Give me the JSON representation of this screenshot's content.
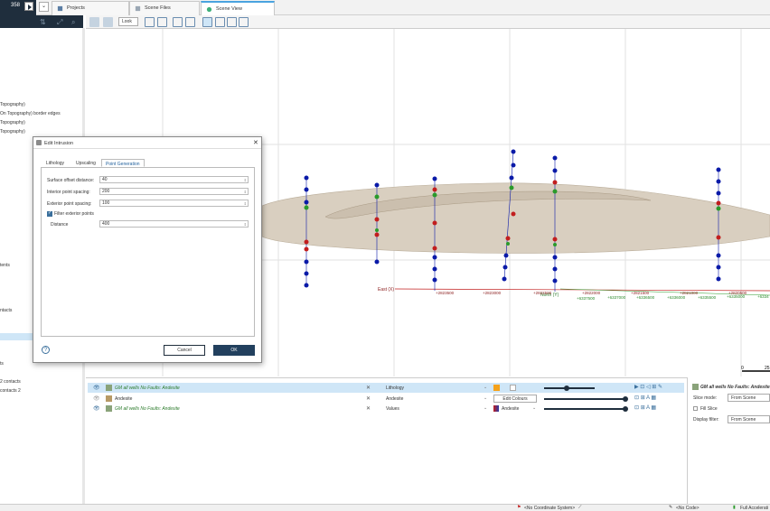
{
  "top": {
    "scene_count": "358",
    "tabs": [
      {
        "label": "Projects"
      },
      {
        "label": "Scene Files"
      },
      {
        "label": "Scene View"
      }
    ]
  },
  "toolbar": {
    "look_label": "Look"
  },
  "left_tree": {
    "items": [
      "Topography)",
      "On Topography) border edges",
      "Topography)",
      "Topography)",
      "tents",
      "ntacts",
      "ts",
      "2 contacts",
      "contacts 2"
    ]
  },
  "viewport": {
    "axis_east_label": "East (X)",
    "axis_north_label": "North (Y)",
    "east_ticks": [
      "+2823500",
      "+2823000",
      "+2822500",
      "+2822000",
      "+2821500",
      "+2821000",
      "+2820500",
      "+2820000"
    ],
    "north_ticks": [
      "+6337500",
      "+6337000",
      "+6336500",
      "+6336000",
      "+6335500",
      "+6335000",
      "+6334"
    ],
    "scale_zero": "0",
    "scale_end": "25"
  },
  "layers": [
    {
      "name": "GM all wells No Faults: Andesite",
      "column": "Lithology",
      "extra": ""
    },
    {
      "name": "Andesite",
      "column": "Andesite",
      "extra": "Edit Colours"
    },
    {
      "name": "GM all wells No Faults: Andesite",
      "column": "Values",
      "extra": "Andesite"
    }
  ],
  "properties": {
    "title": "GM all wells No Faults: Andesite",
    "slice_mode_label": "Slice mode:",
    "slice_mode_value": "From Scene",
    "fill_slice_label": "Fill Slice",
    "display_filter_label": "Display filter:",
    "display_filter_value": "From Scene"
  },
  "dialog": {
    "title": "Edit Intrusion",
    "tabs": [
      "Lithology",
      "Upscaling",
      "Point Generation"
    ],
    "surface_offset_label": "Surface offset distance:",
    "surface_offset_value": "40",
    "interior_spacing_label": "Interior point spacing:",
    "interior_spacing_value": "200",
    "exterior_spacing_label": "Exterior point spacing:",
    "exterior_spacing_value": "100",
    "filter_label": "Filter exterior points",
    "distance_label": "Distance",
    "distance_value": "400",
    "cancel_label": "Cancel",
    "ok_label": "OK",
    "help_label": "?"
  },
  "status": {
    "coord_system": "<No Coordinate System>",
    "code": "<No Code>",
    "accel": "Full Accelerati"
  },
  "colors": {
    "dark_navy": "#1f2e3d",
    "selection_blue": "#cfe6f7",
    "accent_blue": "#4aa3df",
    "surface_tan": "#d9cfc0",
    "drillhole_blue": "#0a1aa8",
    "drillhole_red": "#c21e1e",
    "drillhole_green": "#2a9a2a"
  }
}
